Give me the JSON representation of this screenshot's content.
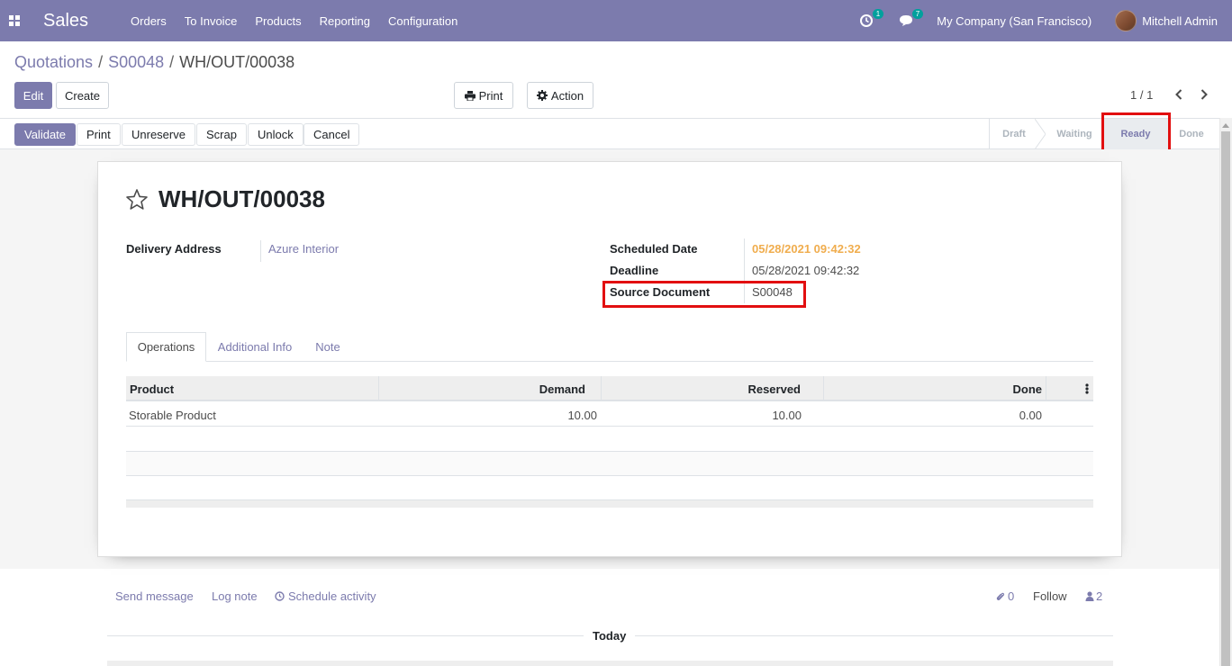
{
  "navbar": {
    "app_name": "Sales",
    "menu": [
      "Orders",
      "To Invoice",
      "Products",
      "Reporting",
      "Configuration"
    ],
    "activity_count": "1",
    "message_count": "7",
    "company": "My Company (San Francisco)",
    "user": "Mitchell Admin"
  },
  "breadcrumb": {
    "items": [
      "Quotations",
      "S00048"
    ],
    "current": "WH/OUT/00038",
    "separator": "/"
  },
  "control": {
    "edit_label": "Edit",
    "create_label": "Create",
    "print_label": "Print",
    "action_label": "Action",
    "pager": "1 / 1"
  },
  "statusbar": {
    "buttons": [
      "Validate",
      "Print",
      "Unreserve",
      "Scrap",
      "Unlock",
      "Cancel"
    ],
    "stages": [
      "Draft",
      "Waiting",
      "Ready",
      "Done"
    ],
    "active_stage": "Ready"
  },
  "form": {
    "title": "WH/OUT/00038",
    "delivery_address_label": "Delivery Address",
    "delivery_address": "Azure Interior",
    "scheduled_date_label": "Scheduled Date",
    "scheduled_date": "05/28/2021 09:42:32",
    "deadline_label": "Deadline",
    "deadline": "05/28/2021 09:42:32",
    "source_document_label": "Source Document",
    "source_document": "S00048"
  },
  "tabs": [
    "Operations",
    "Additional Info",
    "Note"
  ],
  "table": {
    "columns": [
      "Product",
      "Demand",
      "Reserved",
      "Done"
    ],
    "rows": [
      {
        "product": "Storable Product",
        "demand": "10.00",
        "reserved": "10.00",
        "done": "0.00"
      }
    ]
  },
  "chatter": {
    "send_message": "Send message",
    "log_note": "Log note",
    "schedule_activity": "Schedule activity",
    "attachments": "0",
    "follow": "Follow",
    "followers": "2",
    "today": "Today"
  },
  "colors": {
    "brand": "#7c7bad",
    "highlight": "#e20f10",
    "warning": "#f0ad4e"
  }
}
